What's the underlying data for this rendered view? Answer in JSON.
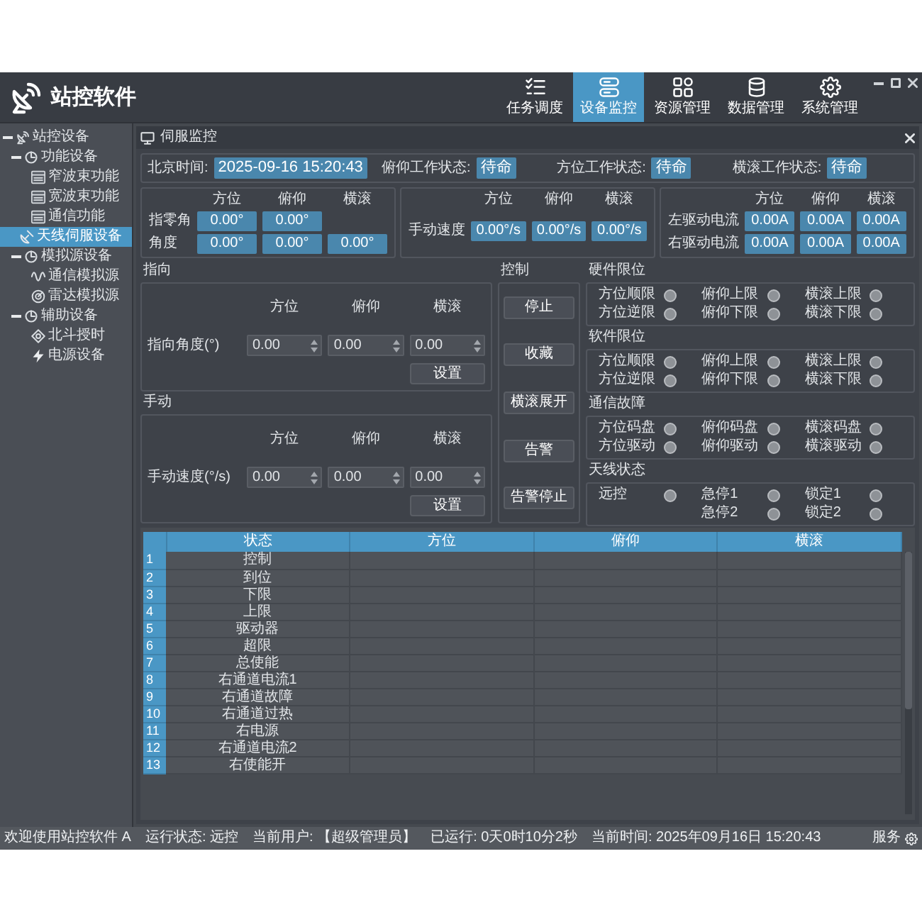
{
  "window": {
    "title": "站控软件"
  },
  "toolbar": [
    {
      "label": "任务调度",
      "selected": false
    },
    {
      "label": "设备监控",
      "selected": true
    },
    {
      "label": "资源管理",
      "selected": false
    },
    {
      "label": "数据管理",
      "selected": false
    },
    {
      "label": "系统管理",
      "selected": false
    }
  ],
  "sidebar": {
    "items": [
      {
        "label": "站控设备",
        "expanded": true,
        "selected": false,
        "children": [
          {
            "label": "功能设备",
            "expanded": true,
            "selected": false,
            "children": [
              {
                "label": "窄波束功能",
                "selected": false
              },
              {
                "label": "宽波束功能",
                "selected": false
              },
              {
                "label": "通信功能",
                "selected": false
              }
            ]
          },
          {
            "label": "天线伺服设备",
            "selected": true
          },
          {
            "label": "模拟源设备",
            "expanded": true,
            "selected": false,
            "children": [
              {
                "label": "通信模拟源",
                "selected": false
              },
              {
                "label": "雷达模拟源",
                "selected": false
              }
            ]
          },
          {
            "label": "辅助设备",
            "expanded": true,
            "selected": false,
            "children": [
              {
                "label": "北斗授时",
                "selected": false
              },
              {
                "label": "电源设备",
                "selected": false
              }
            ]
          }
        ]
      }
    ]
  },
  "panel": {
    "title": "伺服监控"
  },
  "status_fields": [
    {
      "label": "北京时间:",
      "value": "2025-09-16 15:20:43"
    },
    {
      "label": "俯仰工作状态:",
      "value": "待命"
    },
    {
      "label": "方位工作状态:",
      "value": "待命"
    },
    {
      "label": "横滚工作状态:",
      "value": "待命"
    }
  ],
  "readouts": [
    {
      "columns": [
        "方位",
        "俯仰",
        "横滚"
      ],
      "rows": [
        {
          "label": "指零角",
          "values": [
            "0.00°",
            "0.00°"
          ]
        },
        {
          "label": "角度",
          "values": [
            "0.00°",
            "0.00°",
            "0.00°"
          ]
        }
      ]
    },
    {
      "columns": [
        "方位",
        "俯仰",
        "横滚"
      ],
      "rows": [
        {
          "label": "手动速度",
          "values": [
            "0.00°/s",
            "0.00°/s",
            "0.00°/s"
          ]
        }
      ]
    },
    {
      "columns": [
        "方位",
        "俯仰",
        "横滚"
      ],
      "rows": [
        {
          "label": "左驱动电流",
          "values": [
            "0.00A",
            "0.00A",
            "0.00A"
          ]
        },
        {
          "label": "右驱动电流",
          "values": [
            "0.00A",
            "0.00A",
            "0.00A"
          ]
        }
      ]
    }
  ],
  "setpoints": [
    {
      "title": "指向",
      "columns": [
        "方位",
        "俯仰",
        "横滚"
      ],
      "label": "指向角度(°)",
      "inputs": [
        "0.00",
        "0.00",
        "0.00"
      ],
      "button": "设置"
    },
    {
      "title": "手动",
      "columns": [
        "方位",
        "俯仰",
        "横滚"
      ],
      "label": "手动速度(°/s)",
      "inputs": [
        "0.00",
        "0.00",
        "0.00"
      ],
      "button": "设置"
    }
  ],
  "control": {
    "title": "控制",
    "buttons": [
      "停止",
      "收藏",
      "横滚展开",
      "告警",
      "告警停止"
    ],
    "groups": [
      {
        "title": "硬件限位",
        "columns": [
          [
            {
              "label": "方位顺限",
              "on": false
            },
            {
              "label": "方位逆限",
              "on": false
            }
          ],
          [
            {
              "label": "俯仰上限",
              "on": false
            },
            {
              "label": "俯仰下限",
              "on": false
            }
          ],
          [
            {
              "label": "横滚上限",
              "on": false
            },
            {
              "label": "横滚下限",
              "on": false
            }
          ]
        ]
      },
      {
        "title": "软件限位",
        "columns": [
          [
            {
              "label": "方位顺限",
              "on": false
            },
            {
              "label": "方位逆限",
              "on": false
            }
          ],
          [
            {
              "label": "俯仰上限",
              "on": false
            },
            {
              "label": "俯仰下限",
              "on": false
            }
          ],
          [
            {
              "label": "横滚上限",
              "on": false
            },
            {
              "label": "横滚下限",
              "on": false
            }
          ]
        ]
      },
      {
        "title": "通信故障",
        "columns": [
          [
            {
              "label": "方位码盘",
              "on": false
            },
            {
              "label": "方位驱动",
              "on": false
            }
          ],
          [
            {
              "label": "俯仰码盘",
              "on": false
            },
            {
              "label": "俯仰驱动",
              "on": false
            }
          ],
          [
            {
              "label": "横滚码盘",
              "on": false
            },
            {
              "label": "横滚驱动",
              "on": false
            }
          ]
        ]
      },
      {
        "title": "天线状态",
        "columns": [
          [
            {
              "label": "远控",
              "on": false
            }
          ],
          [
            {
              "label": "急停1",
              "on": false
            },
            {
              "label": "急停2",
              "on": false
            }
          ],
          [
            {
              "label": "锁定1",
              "on": false
            },
            {
              "label": "锁定2",
              "on": false
            }
          ]
        ]
      }
    ]
  },
  "table": {
    "columns": [
      "状态",
      "方位",
      "俯仰",
      "横滚"
    ],
    "rows": [
      {
        "number": "1",
        "status": "控制"
      },
      {
        "number": "2",
        "status": "到位"
      },
      {
        "number": "3",
        "status": "下限"
      },
      {
        "number": "4",
        "status": "上限"
      },
      {
        "number": "5",
        "status": "驱动器"
      },
      {
        "number": "6",
        "status": "超限"
      },
      {
        "number": "7",
        "status": "总使能"
      },
      {
        "number": "8",
        "status": "右通道电流1"
      },
      {
        "number": "9",
        "status": "右通道故障"
      },
      {
        "number": "10",
        "status": "右通道过热"
      },
      {
        "number": "11",
        "status": "右电源"
      },
      {
        "number": "12",
        "status": "右通道电流2"
      },
      {
        "number": "13",
        "status": "右使能开"
      }
    ]
  },
  "status_bar": {
    "items": [
      "欢迎使用站控软件 A",
      "运行状态: 远控",
      "当前用户: 【超级管理员】",
      "已运行: 0天0时10分2秒",
      "当前时间: 2025年09月16日 15:20:43"
    ],
    "right": "服务"
  }
}
